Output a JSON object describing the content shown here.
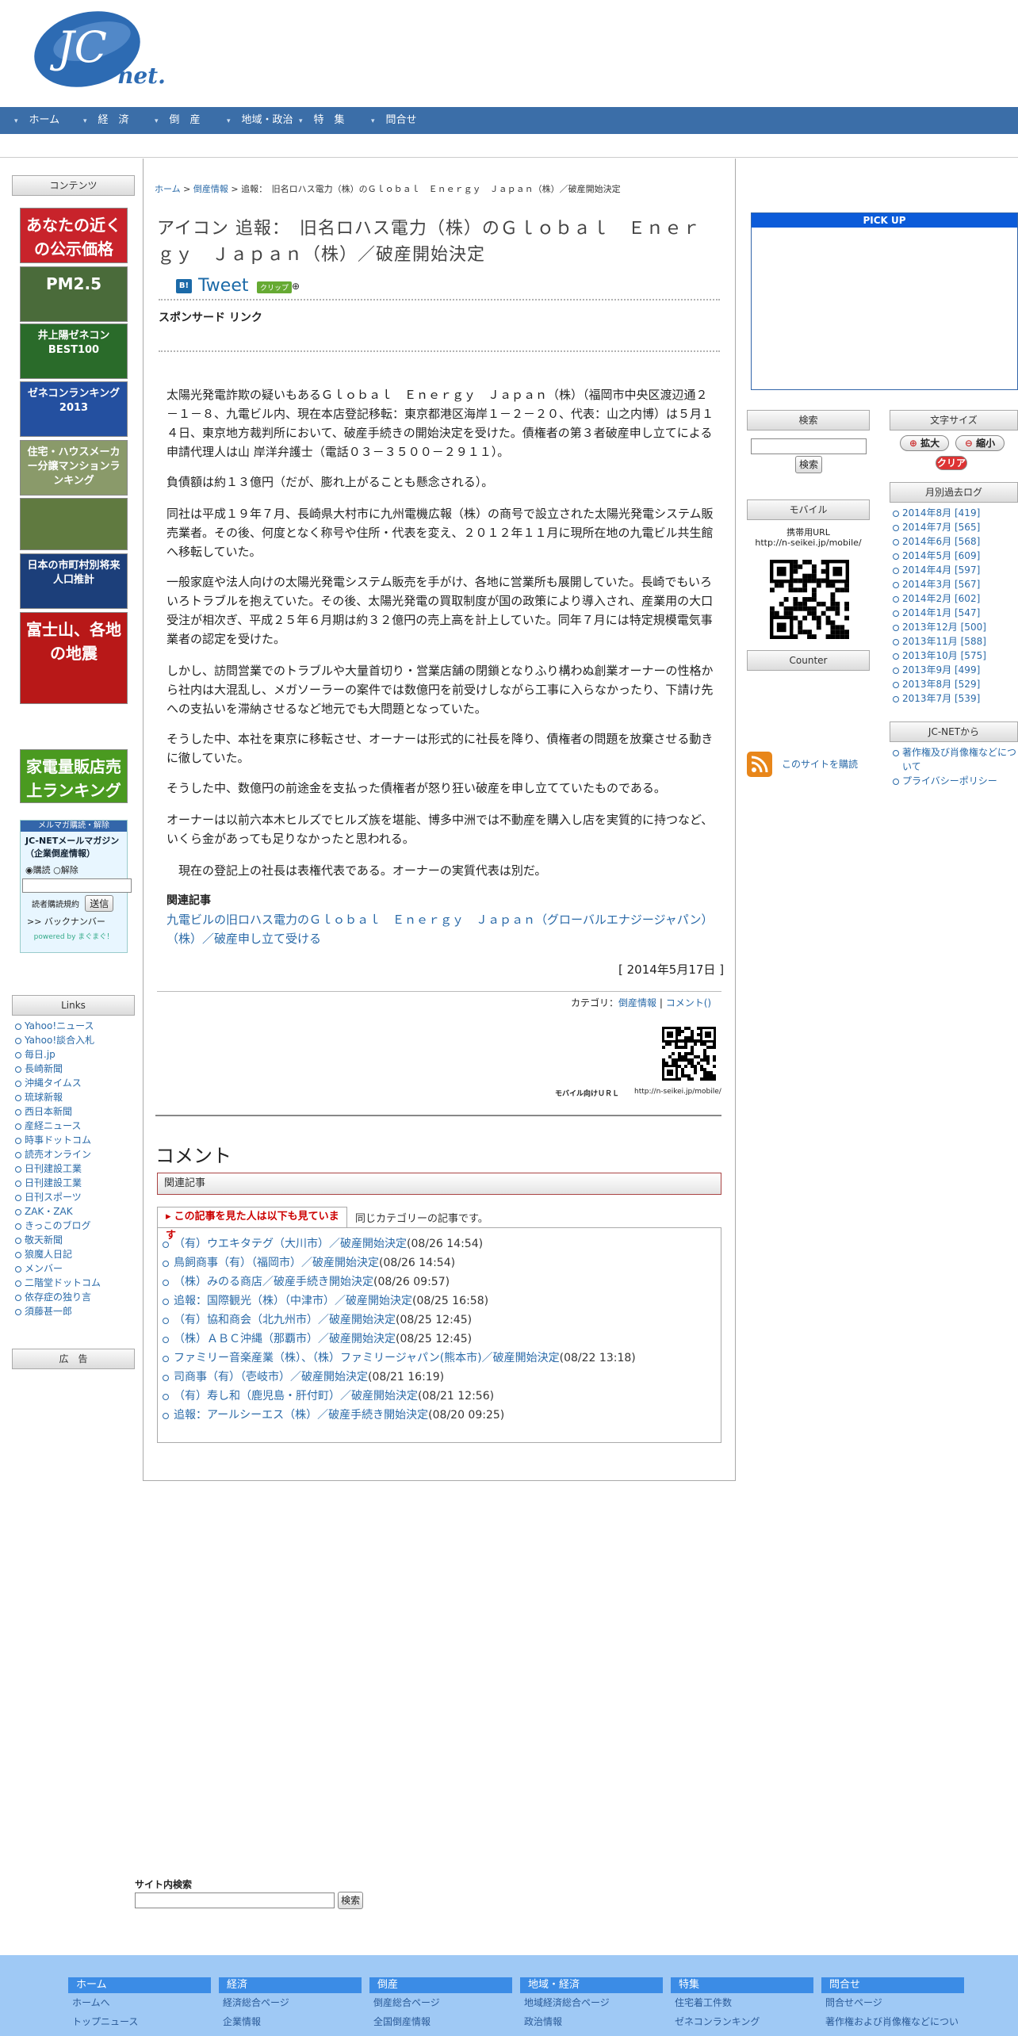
{
  "header": {
    "logo_text": "JC",
    "logo_sub": "net."
  },
  "nav": [
    "ホーム",
    "経　済",
    "倒　産",
    "地域・政治",
    "特　集",
    "問合せ"
  ],
  "left": {
    "contents_title": "コンテンツ",
    "banners": [
      {
        "text": "あなたの近くの公示価格",
        "bg": "#c8232b"
      },
      {
        "text": "PM2.5",
        "bg": "#4a6b3a"
      },
      {
        "text": "井上陽ゼネコンBEST100",
        "bg": "#2a6b2a"
      },
      {
        "text": "ゼネコンランキング2013",
        "bg": "#2450a0"
      },
      {
        "text": "住宅・ハウスメーカー分譲マンションランキング",
        "bg": "#8a9a6a"
      },
      {
        "text": "",
        "bg": "#607a40"
      },
      {
        "text": "日本の市町村別将来人口推計",
        "bg": "#1c3f7a"
      },
      {
        "text": "富士山、各地の地震",
        "bg": "#b81818"
      },
      {
        "text": "家電量販店売上ランキング",
        "bg": "#4a9a20"
      }
    ],
    "mailmag": {
      "head": "メルマガ購読・解除",
      "title": "JC-NETメールマガジン（企業倒産情報）",
      "sub_label": "購読",
      "unsub_label": "解除",
      "terms": "読者購読規約",
      "send": "送信",
      "backnumber": ">> バックナンバー",
      "powered": "powered by まぐまぐ！"
    },
    "links_title": "Links",
    "links": [
      "Yahoo!ニュース",
      "Yahoo!談合入札",
      "毎日.jp",
      "長崎新聞",
      "沖縄タイムス",
      "琉球新報",
      "西日本新聞",
      "産経ニュース",
      "時事ドットコム",
      "読売オンライン",
      "日刊建設工業",
      "日刊建設工業",
      "日刊スポーツ",
      "ZAK・ZAK",
      "きっこのブログ",
      "敬天新聞",
      "狼魔人日記",
      "メンバー",
      "二階堂ドットコム",
      "依存症の独り言",
      "須藤甚一郎"
    ],
    "ad_title": "広　告"
  },
  "article": {
    "breadcrumb": [
      "ホーム",
      "倒産情報",
      "追報：　旧名ロハス電力（株）のＧｌｏｂａｌ　Ｅｎｅｒｇｙ　Ｊａｐａｎ（株）／破産開始決定"
    ],
    "title": "アイコン 追報：　旧名ロハス電力（株）のＧｌｏｂａｌ　Ｅｎｅｒｇｙ　Ｊａｐａｎ（株）／破産開始決定",
    "tweet": "Tweet",
    "clip": "クリップ",
    "sponsor": "スポンサード リンク",
    "paragraphs": [
      "太陽光発電詐欺の疑いもあるＧｌｏｂａｌ　Ｅｎｅｒｇｙ　Ｊａｐａｎ（株）（福岡市中央区渡辺通２－１－８、九電ビル内、現在本店登記移転：東京都港区海岸１－２－２０、代表：山之内博）は５月１４日、東京地方裁判所において、破産手続きの開始決定を受けた。債権者の第３者破産申し立てによる申請代理人は山 岸洋弁護士（電話０３－３５００－２９１１）。",
      "負債額は約１３億円（だが、膨れ上がることも懸念される）。",
      "同社は平成１９年７月、長崎県大村市に九州電機広報（株）の商号で設立された太陽光発電システム販売業者。その後、何度となく称号や住所・代表を変え、２０１２年１１月に現所在地の九電ビル共生館へ移転していた。",
      "一般家庭や法人向けの太陽光発電システム販売を手がけ、各地に営業所も展開していた。長崎でもいろいろトラブルを抱えていた。その後、太陽光発電の買取制度が国の政策により導入され、産業用の大口受注が相次ぎ、平成２５年６月期は約３２億円の売上高を計上していた。同年７月には特定規模電気事業者の認定を受けた。",
      "しかし、訪問営業でのトラブルや大量首切り・営業店舗の閉鎖となりふり構わぬ創業オーナーの性格から社内は大混乱し、メガソーラーの案件では数億円を前受けしながら工事に入らなかったり、下請け先への支払いを滞納させるなど地元でも大問題となっていた。",
      "そうした中、本社を東京に移転させ、オーナーは形式的に社長を降り、債権者の問題を放棄させる動きに徹していた。",
      "そうした中、数億円の前途金を支払った債権者が怒り狂い破産を申し立てていたものである。",
      "オーナーは以前六本木ヒルズでヒルズ族を堪能、博多中洲では不動産を購入し店を実質的に持つなど、いくら金があっても足りなかったと思われる。",
      "　現在の登記上の社長は表権代表である。オーナーの実質代表は別だ。"
    ],
    "related_label": "関連記事",
    "related_link": "九電ビルの旧ロハス電力のＧｌｏｂａｌ　Ｅｎｅｒｇｙ　Ｊａｐａｎ（グローバルエナジージャパン）（株）／破産申し立て受ける",
    "date": "[ 2014年5月17日 ]",
    "category_label": "カテゴリ：",
    "category": "倒産情報",
    "comment_link": "コメント()",
    "mobile_label": "モバイル向けＵＲＬ",
    "mobile_url": "http://n-seikei.jp/mobile/"
  },
  "comments": {
    "title": "コメント",
    "related_head": "関連記事",
    "tab1": "この記事を見た人は以下も見ています",
    "tab2": "同じカテゴリーの記事です。",
    "items": [
      {
        "t": "（有）ウエキタテグ（大川市）／破産開始決定",
        "d": "(08/26 14:54)"
      },
      {
        "t": "鳥飼商事（有）（福岡市）／破産開始決定",
        "d": "(08/26 14:54)"
      },
      {
        "t": "（株）みのる商店／破産手続き開始決定",
        "d": "(08/26 09:57)"
      },
      {
        "t": "追報：国際観光（株）（中津市）／破産開始決定",
        "d": "(08/25 16:58)"
      },
      {
        "t": "（有）協和商会（北九州市）／破産開始決定",
        "d": "(08/25 12:45)"
      },
      {
        "t": "（株）ＡＢＣ沖縄（那覇市）／破産開始決定",
        "d": "(08/25 12:45)"
      },
      {
        "t": "ファミリー音楽産業（株）、（株）ファミリージャパン(熊本市)／破産開始決定",
        "d": "(08/22 13:18)"
      },
      {
        "t": "司商事（有）（壱岐市）／破産開始決定",
        "d": "(08/21 16:19)"
      },
      {
        "t": "（有）寿し和（鹿児島・肝付町）／破産開始決定",
        "d": "(08/21 12:56)"
      },
      {
        "t": "追報：アールシーエス（株）／破産手続き開始決定",
        "d": "(08/20 09:25)"
      }
    ]
  },
  "right": {
    "pickup": "PICK UP",
    "search_title": "検索",
    "search_btn": "検索",
    "mobile_title": "モバイル",
    "mobile_text": "携帯用URL",
    "mobile_url": "http://n-seikei.jp/mobile/",
    "counter_title": "Counter",
    "rss": "このサイトを購読",
    "fontsize_title": "文字サイズ",
    "enlarge": "拡大",
    "shrink": "縮小",
    "clear": "クリア",
    "archive_title": "月別過去ログ",
    "archive": [
      "2014年8月 [419]",
      "2014年7月 [565]",
      "2014年6月 [568]",
      "2014年5月 [609]",
      "2014年4月 [597]",
      "2014年3月 [567]",
      "2014年2月 [602]",
      "2014年1月 [547]",
      "2013年12月 [500]",
      "2013年11月 [588]",
      "2013年10月 [575]",
      "2013年9月 [499]",
      "2013年8月 [529]",
      "2013年7月 [539]"
    ],
    "jcfrom_title": "JC-NETから",
    "jcfrom": [
      "著作権及び肖像権などについて",
      "プライバシーポリシー"
    ]
  },
  "site_search": {
    "label": "サイト内検索",
    "btn": "検索"
  },
  "footer": [
    {
      "hd": "ホーム",
      "links": [
        "ホームへ",
        "トップニュース"
      ]
    },
    {
      "hd": "経済",
      "links": [
        "経済総合ページ",
        "企業情報"
      ]
    },
    {
      "hd": "倒産",
      "links": [
        "倒産総合ページ",
        "全国倒産情報"
      ]
    },
    {
      "hd": "地域・経済",
      "links": [
        "地域経済総合ページ",
        "政治情報"
      ]
    },
    {
      "hd": "特集",
      "links": [
        "住宅着工件数",
        "ゼネコンランキング"
      ]
    },
    {
      "hd": "問合せ",
      "links": [
        "問合せページ",
        "著作権および肖像権などについて"
      ]
    }
  ],
  "colors": {
    "nav": "#3b6ea8",
    "link": "#2a6aa8",
    "footer": "#9fc9f5"
  }
}
